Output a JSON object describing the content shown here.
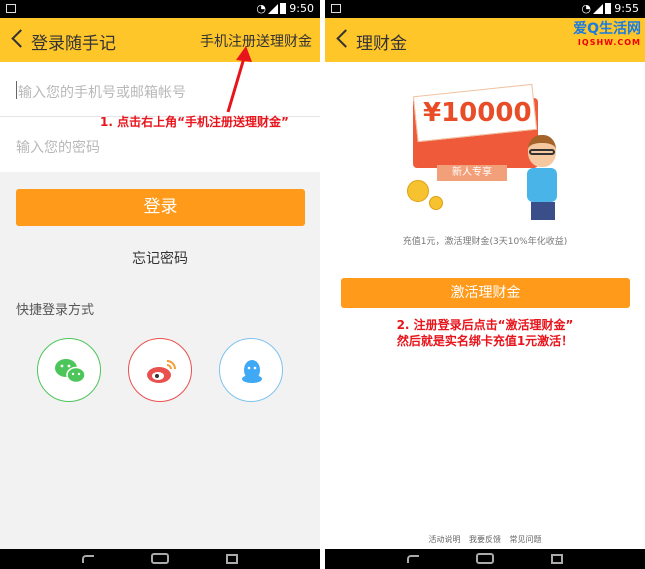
{
  "left": {
    "status_time": "9:50",
    "title": "登录随手记",
    "action": "手机注册送理财金",
    "phone_placeholder": "输入您的手机号或邮箱帐号",
    "password_placeholder": "输入您的密码",
    "login_label": "登录",
    "forgot_label": "忘记密码",
    "quick_login_label": "快捷登录方式",
    "quick_login": [
      {
        "icon": "wechat-icon",
        "color": "#4cc55a"
      },
      {
        "icon": "weibo-icon",
        "color": "#e9514f"
      },
      {
        "icon": "qq-icon",
        "color": "#3fa9f5"
      }
    ],
    "annotation": "1. 点击右上角“手机注册送理财金”"
  },
  "right": {
    "status_time": "9:55",
    "title": "理财金",
    "brand_logo": "爱Q生活网",
    "brand_sub": "IQSHW.COM",
    "hero_amount": "¥10000",
    "hero_ribbon": "新人专享",
    "hint": "充值1元，激活理财金(3天10%年化收益)",
    "activate_label": "激活理财金",
    "annotation_line1": "2. 注册登录后点击“激活理财金”",
    "annotation_line2": "然后就是实名绑卡充值1元激活！",
    "footer_links": [
      "活动说明",
      "我要反馈",
      "常见问题"
    ]
  },
  "colors": {
    "app_bar": "#ffc629",
    "primary_button": "#ff9a1a",
    "annotation": "#e8141c"
  }
}
